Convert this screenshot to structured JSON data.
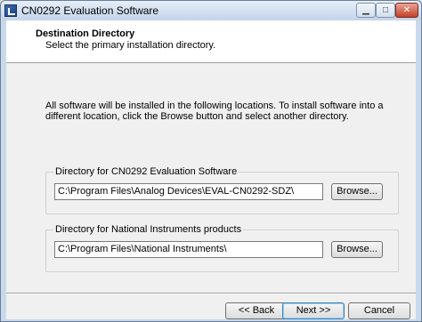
{
  "window": {
    "title": "CN0292 Evaluation Software",
    "icon": "installer-app-icon",
    "controls": {
      "minimize": "▁",
      "maximize": "□",
      "close": "✕"
    }
  },
  "header": {
    "title": "Destination Directory",
    "subtitle": "Select the primary installation directory."
  },
  "info_text": "All software will be installed in the following locations. To install software into a different location, click the Browse button and select another directory.",
  "groups": [
    {
      "label": "Directory for CN0292 Evaluation Software",
      "path": "C:\\Program Files\\Analog Devices\\EVAL-CN0292-SDZ\\",
      "browse_label": "Browse..."
    },
    {
      "label": "Directory for National Instruments products",
      "path": "C:\\Program Files\\National Instruments\\",
      "browse_label": "Browse..."
    }
  ],
  "buttons": {
    "back": "<< Back",
    "next": "Next >>",
    "cancel": "Cancel"
  }
}
